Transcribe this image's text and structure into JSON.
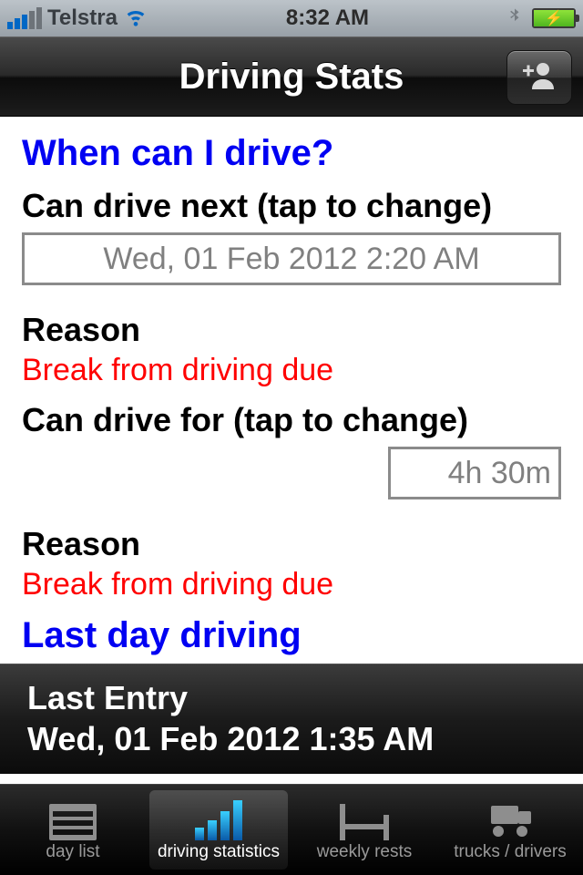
{
  "status": {
    "carrier": "Telstra",
    "time": "8:32 AM"
  },
  "nav": {
    "title": "Driving Stats"
  },
  "main": {
    "section1_title": "When can I drive?",
    "can_drive_next_label": "Can drive next (tap to change)",
    "can_drive_next_value": "Wed, 01 Feb 2012 2:20 AM",
    "reason1_label": "Reason",
    "reason1_value": "Break from driving due",
    "can_drive_for_label": "Can drive for (tap to change)",
    "can_drive_for_value": "4h 30m",
    "reason2_label": "Reason",
    "reason2_value": "Break from driving due",
    "section2_title": "Last day driving",
    "last_entry_label": "Last Entry",
    "last_entry_value": "Wed, 01 Feb 2012 1:35 AM"
  },
  "tabs": {
    "items": [
      {
        "label": "day list"
      },
      {
        "label": "driving statistics"
      },
      {
        "label": "weekly rests"
      },
      {
        "label": "trucks / drivers"
      }
    ],
    "activeIndex": 1
  }
}
